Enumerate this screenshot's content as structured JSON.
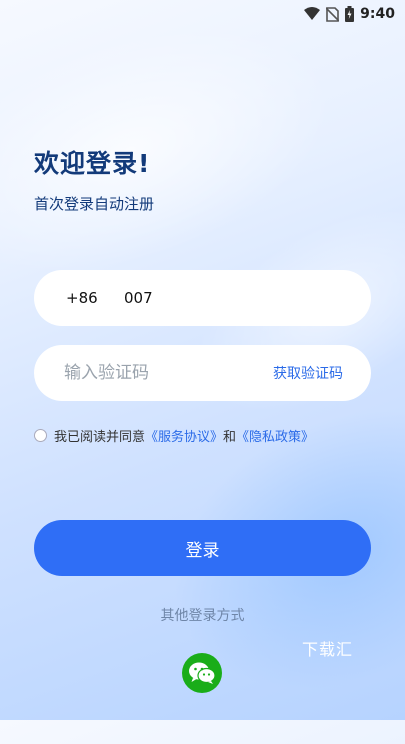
{
  "status_bar": {
    "time": "9:40",
    "icons": [
      "wifi-icon",
      "no-sim-icon",
      "battery-icon"
    ]
  },
  "header": {
    "title": "欢迎登录!",
    "subtitle": "首次登录自动注册"
  },
  "phone": {
    "country_code": "+86",
    "number": "007"
  },
  "code": {
    "placeholder": "输入验证码",
    "get_code_label": "获取验证码"
  },
  "agreement": {
    "prefix": "我已阅读并同意",
    "service": "《服务协议》",
    "and": "和",
    "privacy": "《隐私政策》"
  },
  "login_label": "登录",
  "other_login_label": "其他登录方式",
  "watermark": "下载汇",
  "colors": {
    "primary": "#2f6ef6",
    "link": "#2b6be8",
    "title": "#123a7a",
    "wechat": "#1aad19"
  }
}
